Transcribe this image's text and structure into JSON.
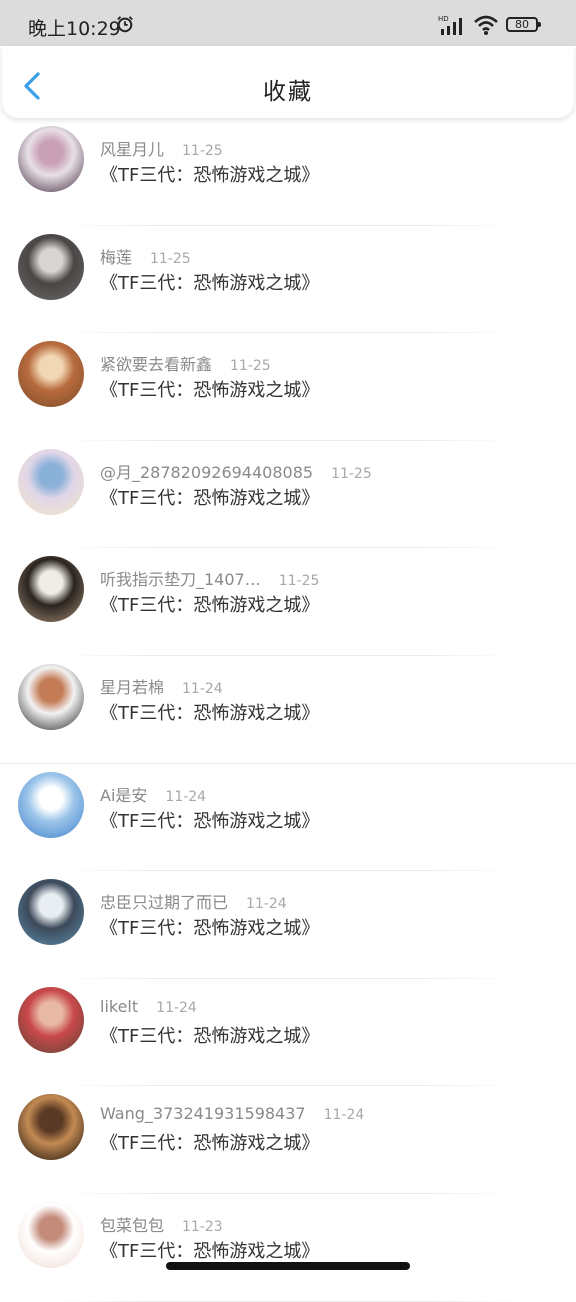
{
  "status_bar": {
    "time": "晚上10:29",
    "battery": "80"
  },
  "header": {
    "title": "收藏"
  },
  "favorites": [
    {
      "user": "风星月儿",
      "date": "11-25",
      "title": "《TF三代：恐怖游戏之城》",
      "avatar_colors": [
        "#3b2538",
        "#c9a0b6",
        "#e8e0e6"
      ]
    },
    {
      "user": "梅莲",
      "date": "11-25",
      "title": "《TF三代：恐怖游戏之城》",
      "avatar_colors": [
        "#6d6a68",
        "#d8d6d2",
        "#4a4646"
      ]
    },
    {
      "user": "紧欲要去看新鑫",
      "date": "11-25",
      "title": "《TF三代：恐怖游戏之城》",
      "avatar_colors": [
        "#7a4a2a",
        "#f2d7b4",
        "#b86b3d"
      ]
    },
    {
      "user": "@月_28782092694408085",
      "date": "11-25",
      "title": "《TF三代：恐怖游戏之城》",
      "avatar_colors": [
        "#f3e6c6",
        "#8ab1d8",
        "#e0d6e8"
      ]
    },
    {
      "user": "听我指示垫刀_1407…",
      "date": "11-25",
      "title": "《TF三代：恐怖游戏之城》",
      "avatar_colors": [
        "#a88f76",
        "#f0ece6",
        "#2a2420"
      ]
    },
    {
      "user": "星月若棉",
      "date": "11-24",
      "title": "《TF三代：恐怖游戏之城》",
      "avatar_colors": [
        "#1d1d1f",
        "#c47c56",
        "#f2f2f2"
      ]
    },
    {
      "user": "Ai是安",
      "date": "11-24",
      "title": "《TF三代：恐怖游戏之城》",
      "avatar_colors": [
        "#3d7fc8",
        "#ffffff",
        "#9cc5ea"
      ]
    },
    {
      "user": "忠臣只过期了而已",
      "date": "11-24",
      "title": "《TF三代：恐怖游戏之城》",
      "avatar_colors": [
        "#5f8fb0",
        "#e9eef2",
        "#3c4a5a"
      ]
    },
    {
      "user": "likelt",
      "date": "11-24",
      "title": "《TF三代：恐怖游戏之城》",
      "avatar_colors": [
        "#5a4536",
        "#e8b9a6",
        "#c9484a"
      ]
    },
    {
      "user": "Wang_373241931598437",
      "date": "11-24",
      "title": "《TF三代：恐怖游戏之城》",
      "avatar_colors": [
        "#120c0a",
        "#5a3a24",
        "#c38a52"
      ]
    },
    {
      "user": "包菜包包",
      "date": "11-23",
      "title": "《TF三代：恐怖游戏之城》",
      "avatar_colors": [
        "#f0d8d0",
        "#c48a7a",
        "#ffffff"
      ]
    }
  ]
}
